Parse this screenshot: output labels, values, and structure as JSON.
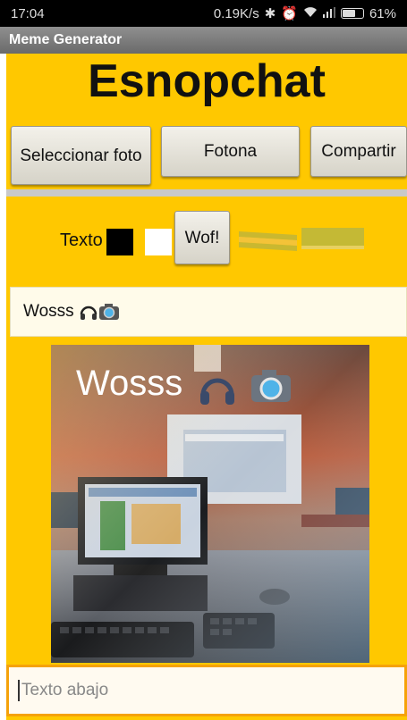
{
  "statusbar": {
    "time": "17:04",
    "network_speed": "0.19K/s",
    "battery": "61%"
  },
  "app": {
    "title": "Meme Generator",
    "heading": "Esnopchat"
  },
  "buttons": {
    "select_photo": "Seleccionar foto",
    "take_photo": "Fotona",
    "share": "Compartir",
    "apply": "Wof!"
  },
  "text_controls": {
    "label": "Texto",
    "text_color": "#000000",
    "bg_color": "#ffffff"
  },
  "top_text": {
    "value": "Wosss"
  },
  "meme": {
    "caption": "Wosss"
  },
  "bottom_text": {
    "placeholder": "Texto abajo"
  },
  "colors": {
    "accent": "#ffc800",
    "focus_border": "#f5a20a"
  }
}
